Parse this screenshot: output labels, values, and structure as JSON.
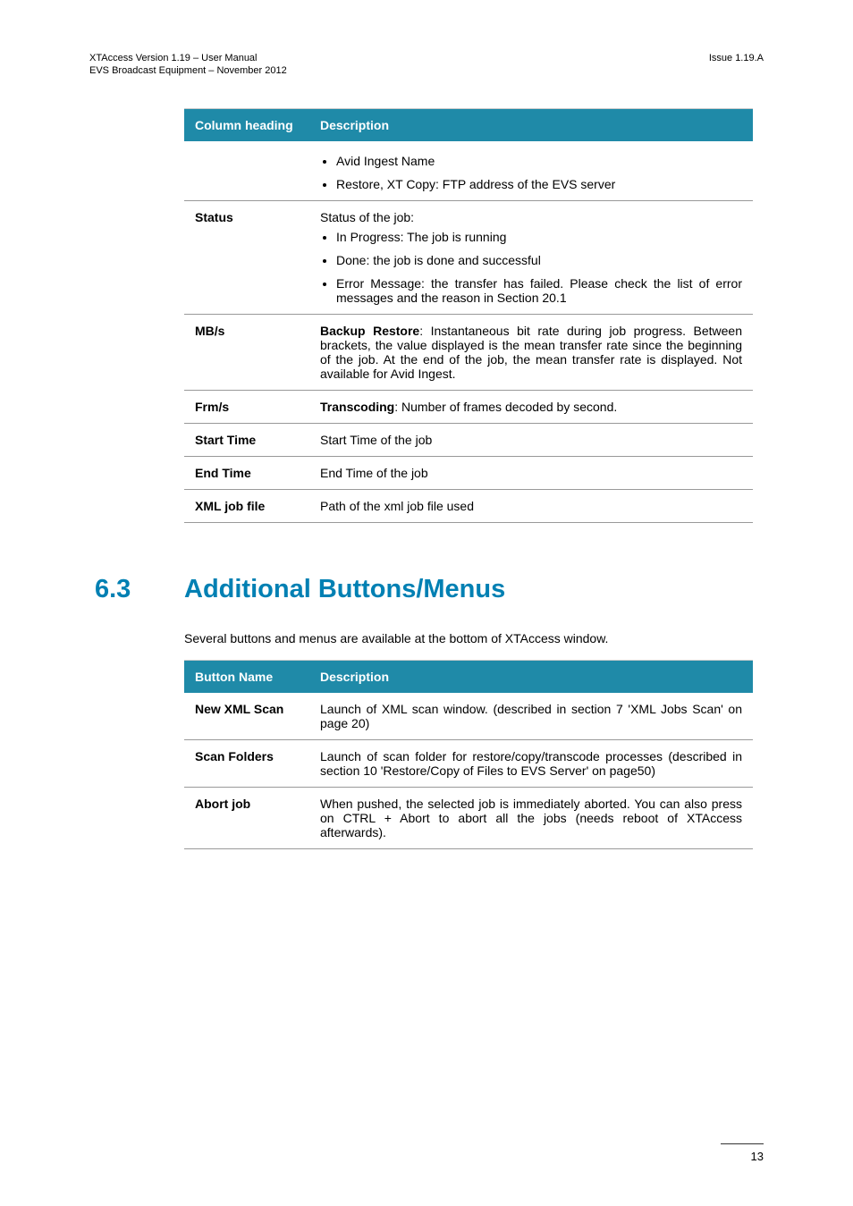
{
  "header": {
    "title": "XTAccess Version 1.19 – User Manual",
    "subtitle": "EVS Broadcast Equipment – November 2012",
    "issue": "Issue 1.19.A"
  },
  "table1": {
    "col1": "Column heading",
    "col2": "Description",
    "rows": {
      "r0": {
        "label": "",
        "li1": "Avid Ingest Name",
        "li2": "Restore, XT Copy: FTP address of the EVS server"
      },
      "r1": {
        "label": "Status",
        "intro": "Status of the job:",
        "li1": "In Progress: The job is running",
        "li2": "Done: the job is done and successful",
        "li3": "Error Message: the transfer has failed.  Please check the list of error messages and the reason in Section 20.1"
      },
      "r2": {
        "label": "MB/s",
        "descPrefix": "Backup Restore",
        "descBody": ": Instantaneous bit rate during job progress.  Between brackets, the value displayed is the mean transfer rate since the beginning of the job.  At the end of the job, the mean transfer rate is displayed. Not available for Avid Ingest."
      },
      "r3": {
        "label": "Frm/s",
        "descPrefix": "Transcoding",
        "descBody": ": Number of frames decoded by second."
      },
      "r4": {
        "label": "Start Time",
        "desc": "Start Time of the job"
      },
      "r5": {
        "label": "End Time",
        "desc": "End Time of the job"
      },
      "r6": {
        "label": "XML job file",
        "desc": "Path of the xml job file used"
      }
    }
  },
  "section": {
    "number": "6.3",
    "title": "Additional Buttons/Menus",
    "intro": "Several buttons and menus are available at the bottom of XTAccess window."
  },
  "table2": {
    "col1": "Button Name",
    "col2": "Description",
    "rows": {
      "r0": {
        "label": "New XML Scan",
        "desc": "Launch of XML scan window.  (described in section 7 'XML Jobs Scan' on page 20)"
      },
      "r1": {
        "label": "Scan Folders",
        "desc": "Launch of scan folder for restore/copy/transcode processes (described in section 10 'Restore/Copy of Files to EVS Server' on page50)"
      },
      "r2": {
        "label": "Abort job",
        "desc": "When pushed, the selected job is immediately aborted. You can also press on CTRL + Abort to abort all the jobs (needs reboot of XTAccess afterwards)."
      }
    }
  },
  "footer": {
    "page": "13"
  }
}
